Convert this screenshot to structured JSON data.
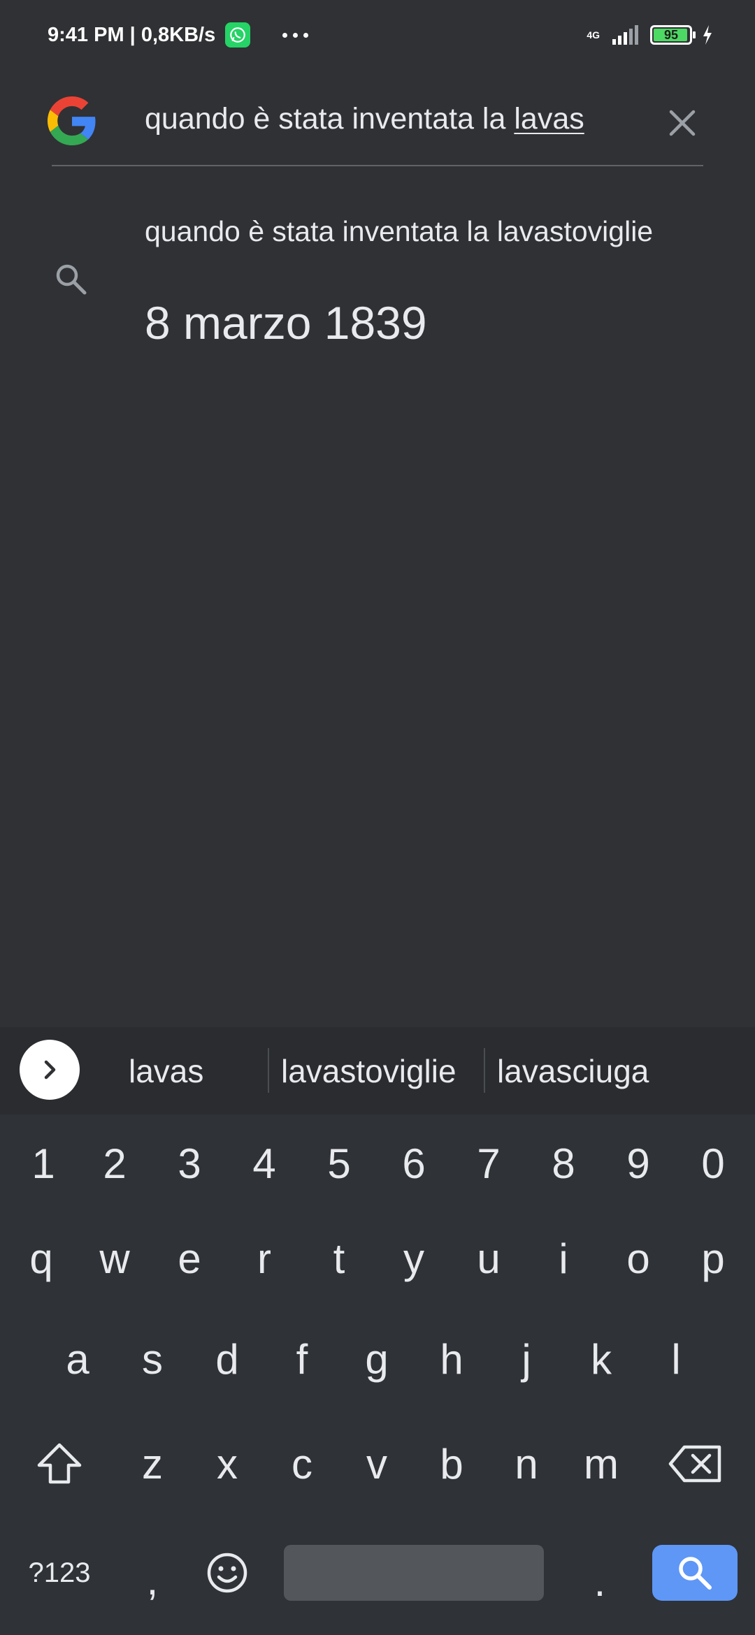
{
  "status_bar": {
    "time": "9:41 PM | 0,8KB/s",
    "network": "4G",
    "battery": "95"
  },
  "search": {
    "query_prefix": "quando è stata inventata la ",
    "query_underlined": "lavas"
  },
  "suggestion": {
    "query": "quando è stata inventata la lavastoviglie",
    "answer": "8 marzo 1839"
  },
  "keyboard_suggestions": [
    "lavas",
    "lavastoviglie",
    "lavasciuga"
  ],
  "keyboard": {
    "numbers": [
      "1",
      "2",
      "3",
      "4",
      "5",
      "6",
      "7",
      "8",
      "9",
      "0"
    ],
    "row1": [
      "q",
      "w",
      "e",
      "r",
      "t",
      "y",
      "u",
      "i",
      "o",
      "p"
    ],
    "row2": [
      "a",
      "s",
      "d",
      "f",
      "g",
      "h",
      "j",
      "k",
      "l"
    ],
    "row3": [
      "z",
      "x",
      "c",
      "v",
      "b",
      "n",
      "m"
    ],
    "symbols_label": "?123",
    "comma": ",",
    "period": "."
  },
  "colors": {
    "background": "#303134",
    "keyboard": "#2f3236",
    "search_key": "#5e97f6"
  }
}
